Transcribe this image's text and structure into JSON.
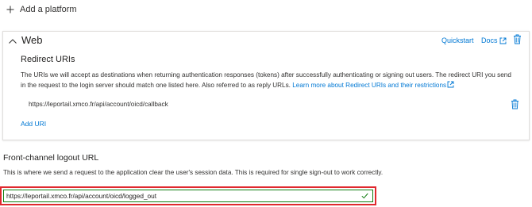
{
  "add_platform": {
    "label": "Add a platform",
    "icon": "plus-icon"
  },
  "web_card": {
    "title": "Web",
    "quickstart_label": "Quickstart",
    "docs_label": "Docs",
    "redirect_uris": {
      "title": "Redirect URIs",
      "description": "The URIs we will accept as destinations when returning authentication responses (tokens) after successfully authenticating or signing out users. The redirect URI you send in the request to the login server should match one listed here. Also referred to as reply URLs.",
      "learn_more_label": "Learn more about Redirect URIs and their restrictions",
      "uris": [
        "https://leportail.xmco.fr/api/account/oicd/callback"
      ],
      "add_uri_label": "Add URI"
    }
  },
  "front_channel_logout": {
    "title": "Front-channel logout URL",
    "description": "This is where we send a request to the application clear the user's session data. This is required for single sign-out to work correctly.",
    "value": "https://leportail.xmco.fr/api/account/oicd/logged_out"
  },
  "colors": {
    "link": "#0078d4",
    "valid": "#107c10",
    "highlight": "#e0282e",
    "text": "#323130"
  }
}
